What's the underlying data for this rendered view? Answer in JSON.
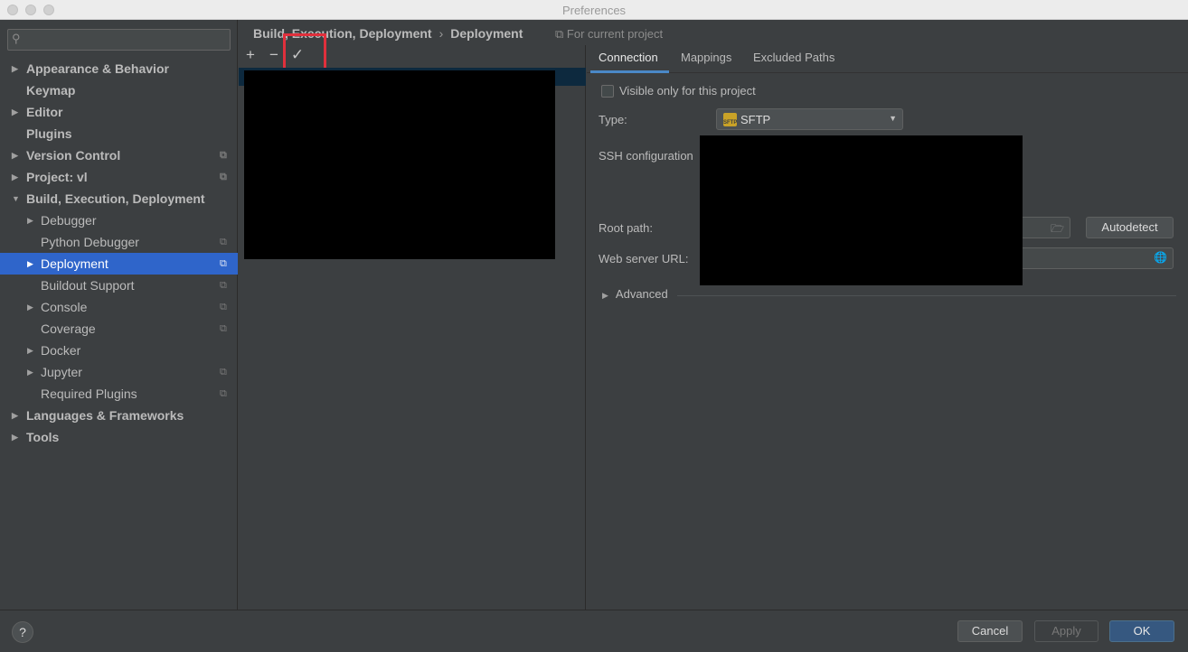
{
  "window": {
    "title": "Preferences"
  },
  "search": {
    "placeholder": ""
  },
  "sidebar": {
    "items": [
      {
        "label": "Appearance & Behavior",
        "arrow": "▶",
        "copy": ""
      },
      {
        "label": "Keymap",
        "arrow": "",
        "copy": ""
      },
      {
        "label": "Editor",
        "arrow": "▶",
        "copy": ""
      },
      {
        "label": "Plugins",
        "arrow": "",
        "copy": ""
      },
      {
        "label": "Version Control",
        "arrow": "▶",
        "copy": "⧉"
      },
      {
        "label": "Project: vl",
        "arrow": "▶",
        "copy": "⧉"
      },
      {
        "label": "Build, Execution, Deployment",
        "arrow": "▼",
        "copy": ""
      },
      {
        "label": "Debugger",
        "arrow": "▶",
        "copy": ""
      },
      {
        "label": "Python Debugger",
        "arrow": "",
        "copy": "⧉"
      },
      {
        "label": "Deployment",
        "arrow": "▶",
        "copy": "⧉"
      },
      {
        "label": "Buildout Support",
        "arrow": "",
        "copy": "⧉"
      },
      {
        "label": "Console",
        "arrow": "▶",
        "copy": "⧉"
      },
      {
        "label": "Coverage",
        "arrow": "",
        "copy": "⧉"
      },
      {
        "label": "Docker",
        "arrow": "▶",
        "copy": ""
      },
      {
        "label": "Jupyter",
        "arrow": "▶",
        "copy": "⧉"
      },
      {
        "label": "Required Plugins",
        "arrow": "",
        "copy": "⧉"
      },
      {
        "label": "Languages & Frameworks",
        "arrow": "▶",
        "copy": ""
      },
      {
        "label": "Tools",
        "arrow": "▶",
        "copy": ""
      }
    ]
  },
  "header": {
    "breadcrumb": [
      "Build, Execution, Deployment",
      "Deployment"
    ],
    "breadcrumb_separator": "›",
    "scope": "⧉ For current project"
  },
  "server_toolbar": {
    "add": "+",
    "remove": "−",
    "set_default": "✓"
  },
  "tabs": [
    "Connection",
    "Mappings",
    "Excluded Paths"
  ],
  "connection": {
    "visible_only_label": "Visible only for this project",
    "visible_only_checked": false,
    "type_label": "Type:",
    "type_value": "SFTP",
    "type_icon_text": "SFTP",
    "ssh_label": "SSH configuration",
    "root_path_label": "Root path:",
    "autodetect_label": "Autodetect",
    "web_url_label": "Web server URL:",
    "advanced_label": "Advanced"
  },
  "footer": {
    "help": "?",
    "cancel": "Cancel",
    "apply": "Apply",
    "ok": "OK"
  },
  "colors": {
    "selection": "#2f65ca",
    "highlight_box": "#e0303c",
    "ok_button": "#365880"
  }
}
